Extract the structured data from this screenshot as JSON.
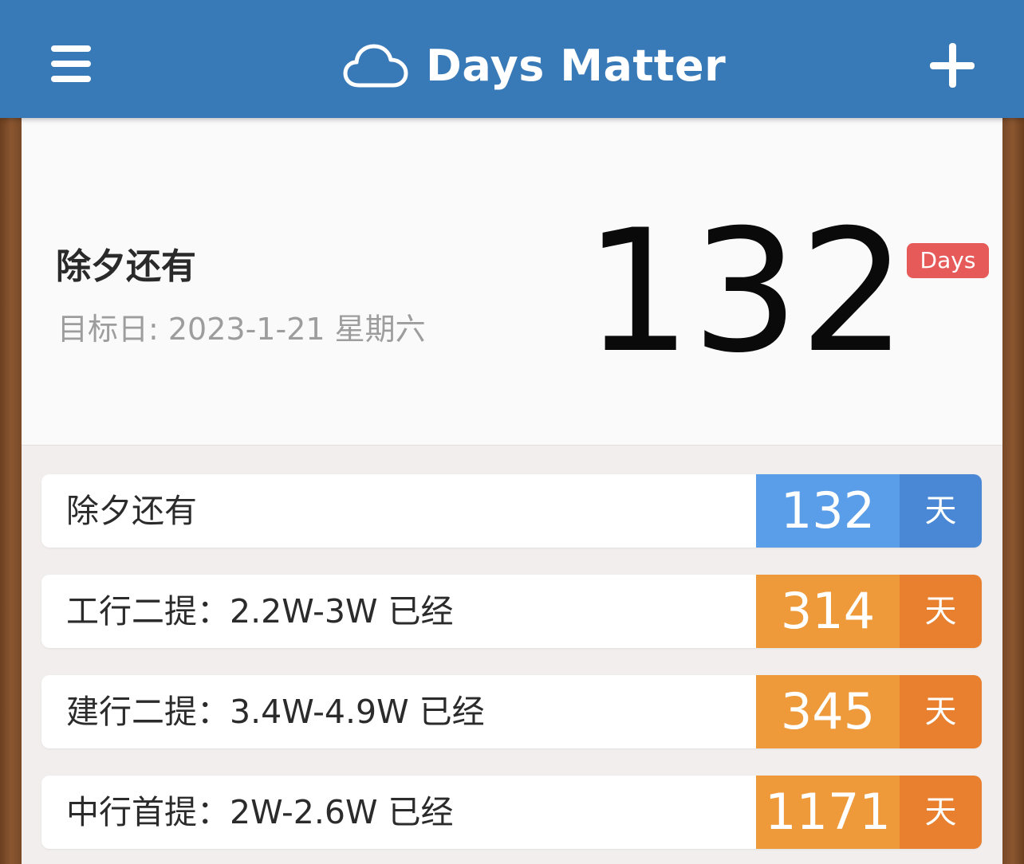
{
  "header": {
    "title": "Days Matter",
    "left_icon": "menu-icon",
    "logo_icon": "cloud-icon",
    "right_icon": "plus-icon",
    "bar_color": "#3879b7"
  },
  "hero": {
    "title": "除夕还有",
    "target_date": "目标日: 2023-1-21 星期六",
    "count": "132",
    "badge": "Days",
    "badge_color": "#e65a5a"
  },
  "events": [
    {
      "label": "除夕还有",
      "count": "132",
      "unit": "天",
      "type": "countdown",
      "num_color": "#5a9de8",
      "unit_color": "#4a88d6"
    },
    {
      "label": "工行二提：2.2W-3W 已经",
      "count": "314",
      "unit": "天",
      "type": "elapsed",
      "num_color": "#ef9a3a",
      "unit_color": "#e8802f"
    },
    {
      "label": "建行二提：3.4W-4.9W 已经",
      "count": "345",
      "unit": "天",
      "type": "elapsed",
      "num_color": "#ef9a3a",
      "unit_color": "#e8802f"
    },
    {
      "label": "中行首提：2W-2.6W 已经",
      "count": "1171",
      "unit": "天",
      "type": "elapsed",
      "num_color": "#ef9a3a",
      "unit_color": "#e8802f"
    }
  ]
}
